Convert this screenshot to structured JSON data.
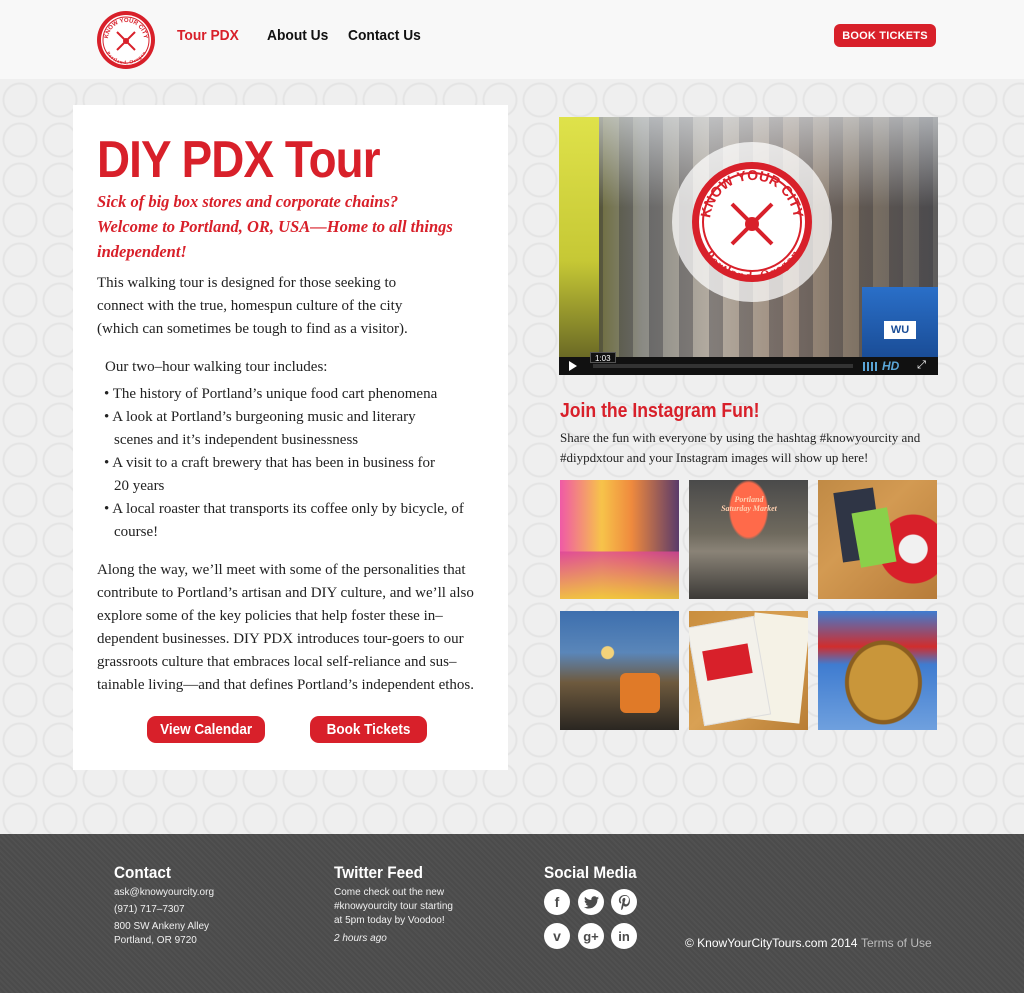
{
  "header": {
    "logo": {
      "top_text": "KNOW YOUR CITY",
      "bottom_text": "Portland, Oregon"
    },
    "nav": [
      {
        "label": "Tour PDX",
        "active": true
      },
      {
        "label": "About Us",
        "active": false
      },
      {
        "label": "Contact Us",
        "active": false
      }
    ],
    "book_button": "BOOK TICKETS"
  },
  "main": {
    "title": "DIY PDX Tour",
    "subtitle": "Sick of big box stores and corporate chains? Welcome to Portland, OR, USA—Home to all things independent!",
    "intro": "This walking tour is designed for those seeking to connect with the true, homespun culture of the city (which can sometimes be tough to find as a visitor).",
    "includes_heading": "Our two–hour walking tour includes:",
    "bullets": [
      "The history of Portland’s unique food cart phenomena",
      "A look at Portland’s burgeoning music and literary scenes and it’s independent businessness",
      "A visit to a craft brewery that has been in business for 20 years",
      "A local roaster that transports its coffee only by bicycle, of course!"
    ],
    "closing": "Along the way, we’ll meet with some of the personalities that contribute to Portland’s artisan and DIY culture, and we’ll also explore some of the key policies that help foster these in–dependent businesses. DIY PDX introduces tour-goers to our grassroots culture that embraces local self-reliance and sus–tainable living—and that defines Portland’s independent ethos.",
    "buttons": {
      "calendar": "View Calendar",
      "book": "Book Tickets"
    }
  },
  "video": {
    "timestamp": "1:03",
    "quality": "HD",
    "badge_top": "KNOW YOUR CITY",
    "badge_bottom": "Portland, Oregon",
    "sign_text": "WU",
    "progress": 0.0
  },
  "instagram": {
    "title": "Join the Instagram Fun!",
    "text": "Share the fun with everyone by using the hashtag #knowyourcity and #diypdxtour and your Instagram images will show up here!",
    "photo_sign": "Portland Saturday Market",
    "photos": [
      "food-cart-interior-photo",
      "saturday-market-photo",
      "postcards-photo",
      "pedicab-photo",
      "postcard-envelope-photo",
      "lion-statue-photo"
    ]
  },
  "footer": {
    "contact": {
      "heading": "Contact",
      "email": "ask@knowyourcity.org",
      "phone": "(971) 717–7307",
      "address_1": "800 SW Ankeny Alley",
      "address_2": "Portland, OR 9720"
    },
    "twitter": {
      "heading": "Twitter Feed",
      "line_1": "Come check out the new",
      "line_2": "#knowyourcity tour starting",
      "line_3": "at 5pm today by Voodoo!",
      "time": "2 hours ago"
    },
    "social": {
      "heading": "Social Media",
      "icons": [
        "facebook-icon",
        "twitter-icon",
        "pinterest-icon",
        "vimeo-icon",
        "google-plus-icon",
        "linkedin-icon"
      ],
      "glyphs": {
        "facebook": "f",
        "google_plus": "g+",
        "linkedin": "in",
        "vimeo": "v"
      }
    },
    "copyright": "© KnowYourCityTours.com 2014",
    "terms": "Terms of Use"
  },
  "colors": {
    "brand_red": "#d8202a",
    "footer_bg": "#4b4b4b",
    "page_bg": "#efefef"
  }
}
